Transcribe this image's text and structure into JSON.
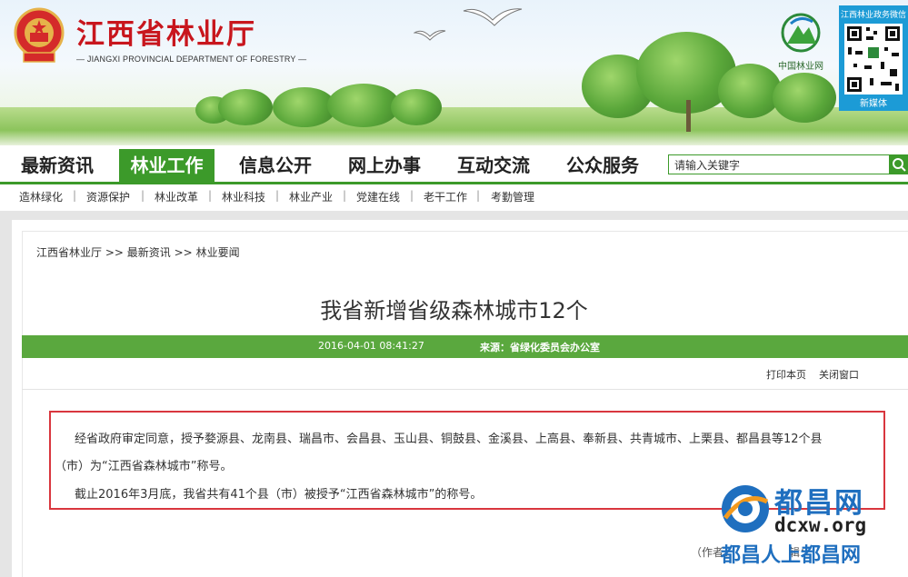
{
  "site": {
    "title": "江西省林业厅",
    "subtitle": "— JIANGXI PROVINCIAL DEPARTMENT OF FORESTRY —",
    "partner_logo_text": "中国林业网",
    "qr_title": "江西林业政务微信",
    "qr_caption": "新媒体"
  },
  "nav": {
    "items": [
      "最新资讯",
      "林业工作",
      "信息公开",
      "网上办事",
      "互动交流",
      "公众服务"
    ],
    "active_index": 1,
    "search_placeholder": "请输入关键字"
  },
  "subnav": {
    "items": [
      "造林绿化",
      "资源保护",
      "林业改革",
      "林业科技",
      "林业产业",
      "党建在线",
      "老干工作",
      "考勤管理"
    ]
  },
  "breadcrumb": [
    "江西省林业厅",
    "最新资讯",
    "林业要闻"
  ],
  "breadcrumb_sep": ">>",
  "article": {
    "title": "我省新增省级森林城市12个",
    "date": "2016-04-01 08:41:27",
    "source": "来源：省绿化委员会办公室",
    "print_label": "打印本页",
    "close_label": "关闭窗口",
    "paragraph1_line1": "经省政府审定同意，授予婺源县、龙南县、瑞昌市、会昌县、玉山县、铜鼓县、金溪县、上高县、奉新县、共青城市、上栗县、都昌县等12个县",
    "paragraph1_line2": "（市）为“江西省森林城市”称号。",
    "paragraph2": "截止2016年3月底，我省共有41个县（市）被授予“江西省森林城市”的称号。",
    "author": "（作者：",
    "author_tail": "辑："
  },
  "watermark": {
    "title": "都昌网",
    "url": "dcxw.org",
    "slogan": "都昌人上都昌网"
  },
  "colors": {
    "brand_green": "#3c9a2a",
    "meta_green": "#5aa83e",
    "title_red": "#c8161d",
    "box_red": "#d9363e",
    "watermark_blue": "#1f6fbf"
  }
}
